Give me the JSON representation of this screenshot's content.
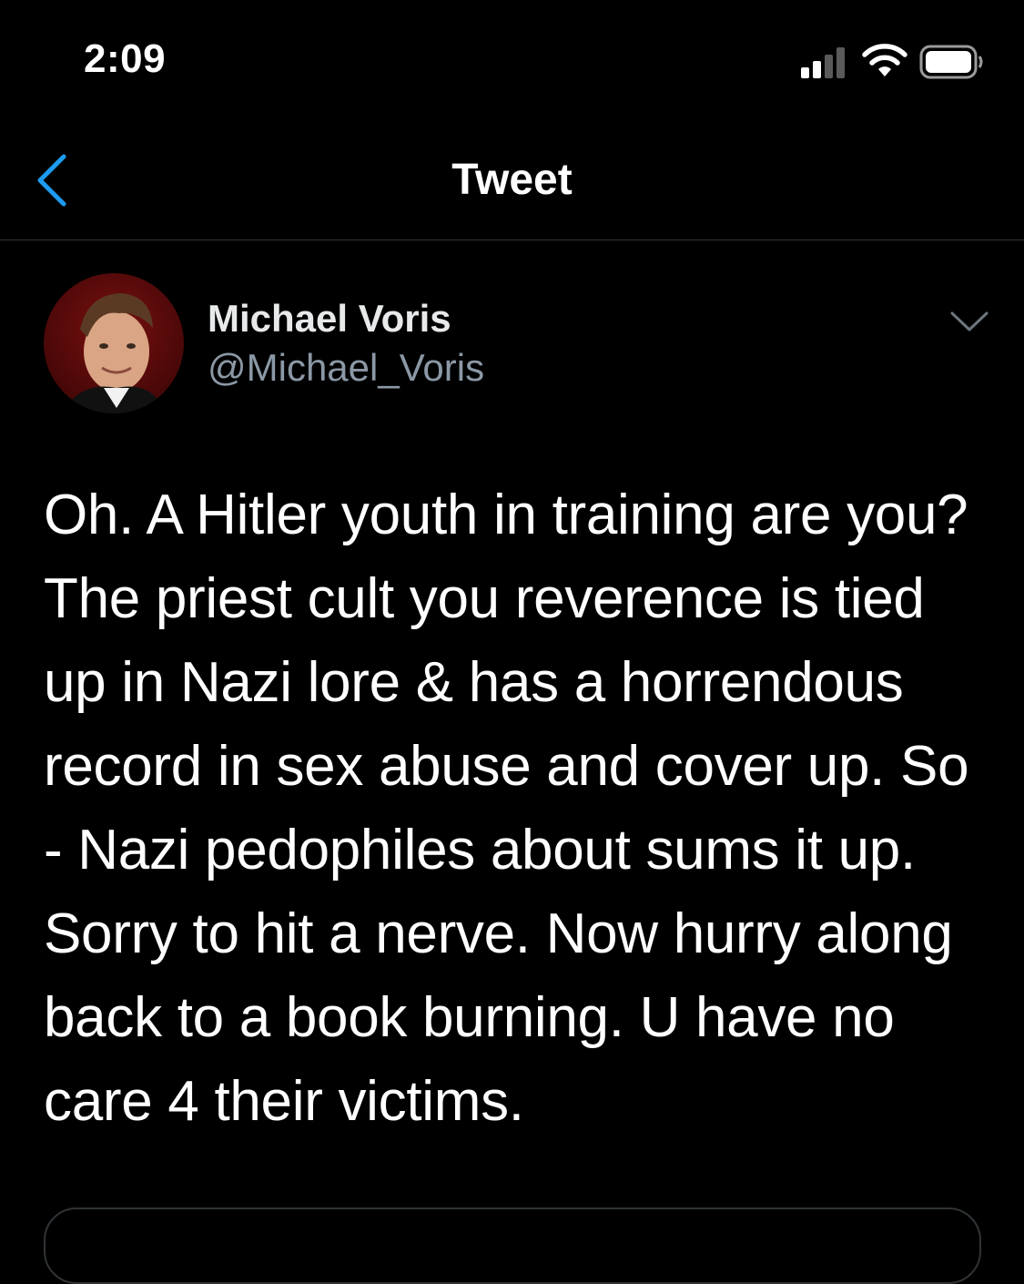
{
  "status_bar": {
    "time": "2:09",
    "signal_icon": "cellular-signal-icon",
    "wifi_icon": "wifi-icon",
    "battery_icon": "battery-icon"
  },
  "header": {
    "back_icon": "chevron-left-icon",
    "title": "Tweet"
  },
  "tweet": {
    "author": {
      "display_name": "Michael Voris",
      "handle": "@Michael_Voris",
      "avatar_icon": "avatar"
    },
    "more_icon": "chevron-down-icon",
    "text": "Oh. A Hitler youth in training are you? The priest cult you reverence is tied up in Nazi lore & has a horrendous record in sex abuse and cover up. So - Nazi pedophiles about sums it up. Sorry to hit a nerve. Now hurry along back to a book burning. U have no care 4 their victims."
  },
  "colors": {
    "background": "#000000",
    "accent": "#1d9bf0",
    "secondary_text": "#8b98a5",
    "divider": "#2f3336"
  }
}
